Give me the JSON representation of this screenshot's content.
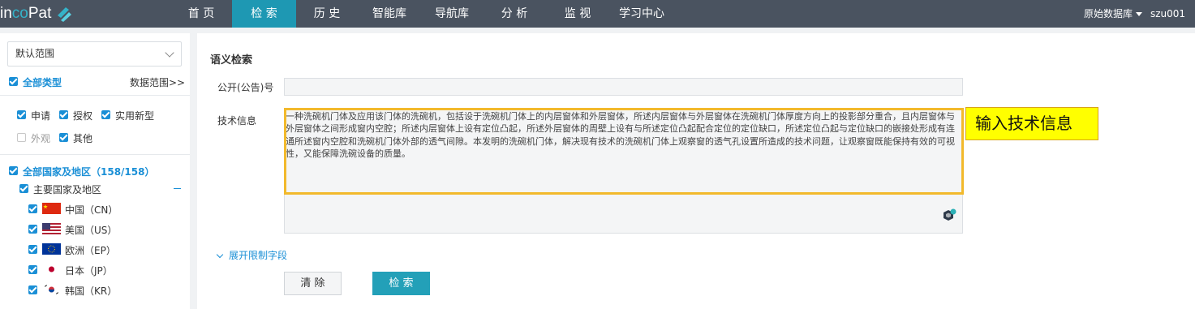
{
  "logo": {
    "text_a": "in",
    "text_b": "co",
    "text_c": "Pat"
  },
  "nav": [
    {
      "label": "首 页",
      "active": false
    },
    {
      "label": "检 索",
      "active": true
    },
    {
      "label": "历 史",
      "active": false
    },
    {
      "label": "智能库",
      "active": false
    },
    {
      "label": "导航库",
      "active": false
    },
    {
      "label": "分 析",
      "active": false
    },
    {
      "label": "监 视",
      "active": false
    },
    {
      "label": "学习中心",
      "active": false
    }
  ],
  "header_right": {
    "database": "原始数据库",
    "user": "szu001"
  },
  "sidebar": {
    "scope_select": "默认范围",
    "all_types": "全部类型",
    "data_range": "数据范围>>",
    "types": [
      {
        "label": "申请",
        "checked": true
      },
      {
        "label": "授权",
        "checked": true
      },
      {
        "label": "实用新型",
        "checked": true
      },
      {
        "label": "外观",
        "checked": false
      },
      {
        "label": "其他",
        "checked": true
      }
    ],
    "all_regions": "全部国家及地区（158/158）",
    "main_regions": "主要国家及地区",
    "countries": [
      {
        "label": "中国（CN）",
        "flag": "cn"
      },
      {
        "label": "美国（US）",
        "flag": "us"
      },
      {
        "label": "欧洲（EP）",
        "flag": "eu"
      },
      {
        "label": "日本（JP）",
        "flag": "jp"
      },
      {
        "label": "韩国（KR）",
        "flag": "kr"
      }
    ]
  },
  "main": {
    "title": "语义检索",
    "pub_label": "公开(公告)号",
    "pub_value": "",
    "tech_label": "技术信息",
    "tech_value": "一种洗碗机门体及应用该门体的洗碗机，包括设于洗碗机门体上的内层窗体和外层窗体，所述内层窗体与外层窗体在洗碗机门体厚度方向上的投影部分重合，且内层窗体与外层窗体之间形成窗内空腔；所述内层窗体上设有定位凸起，所述外层窗体的周壁上设有与所述定位凸起配合定位的定位缺口，所述定位凸起与定位缺口的嵌接处形成有连通所述窗内空腔和洗碗机门体外部的透气间隙。本发明的洗碗机门体，解决现有技术的洗碗机门体上观察窗的透气孔设置所造成的技术问题，让观察窗既能保持有效的可视性，又能保障洗碗设备的质量。",
    "callout": "输入技术信息",
    "expand_link": "展开限制字段",
    "clear_button": "清 除",
    "search_button": "检 索"
  },
  "colors": {
    "topbar": "#4a5360",
    "nav_active": "#1e98b3",
    "accent_blue": "#1a8fd6",
    "search_button": "#23a0b8",
    "highlight_border": "#f2b92c",
    "callout_bg": "#ffff00"
  }
}
